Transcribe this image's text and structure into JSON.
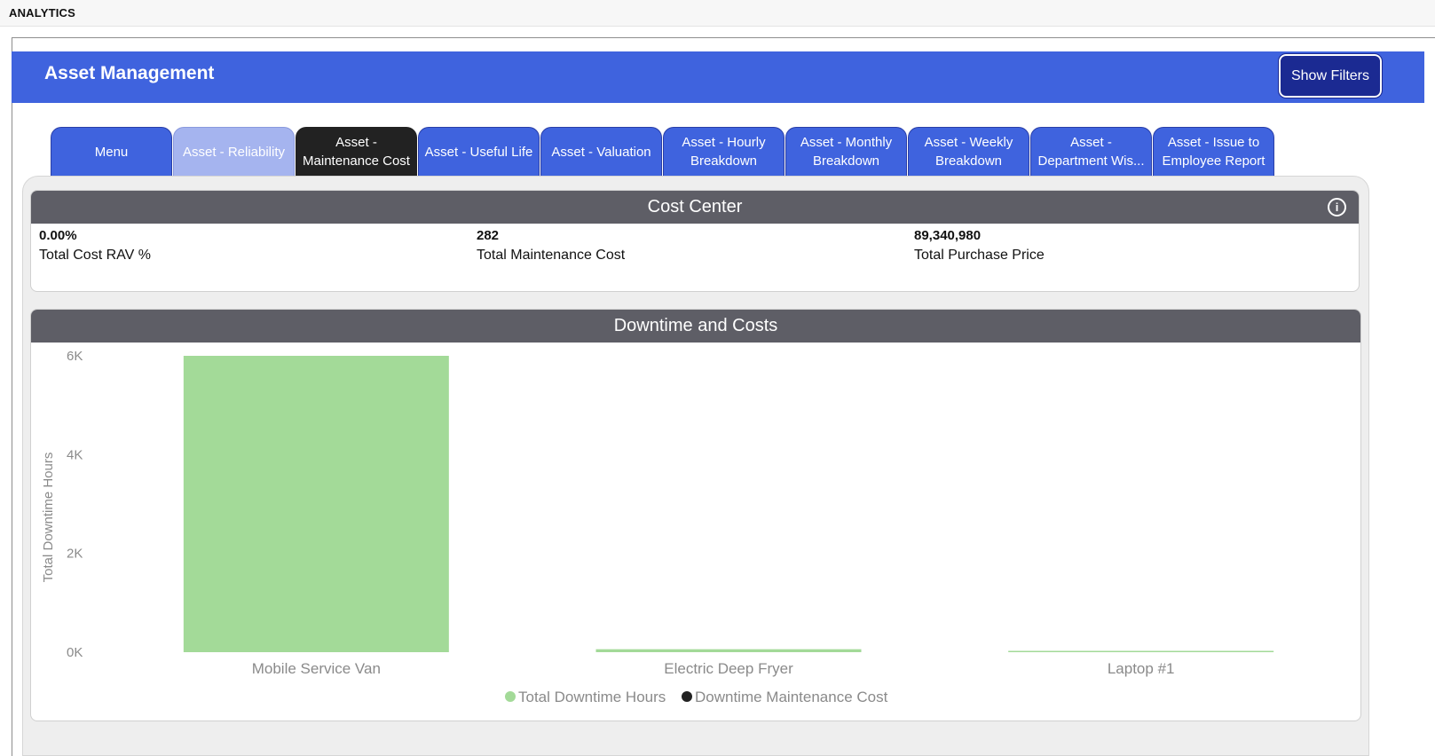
{
  "app": {
    "title": "ANALYTICS"
  },
  "header": {
    "title": "Asset Management",
    "filters_button": "Show Filters"
  },
  "tabs": [
    {
      "label": "Menu",
      "state": "normal"
    },
    {
      "label": "Asset - Reliability",
      "state": "hover"
    },
    {
      "label": "Asset -\nMaintenance Cost",
      "state": "active"
    },
    {
      "label": "Asset - Useful Life",
      "state": "normal"
    },
    {
      "label": "Asset - Valuation",
      "state": "normal"
    },
    {
      "label": "Asset - Hourly\nBreakdown",
      "state": "normal"
    },
    {
      "label": "Asset - Monthly\nBreakdown",
      "state": "normal"
    },
    {
      "label": "Asset - Weekly\nBreakdown",
      "state": "normal"
    },
    {
      "label": "Asset -\nDepartment Wis...",
      "state": "normal"
    },
    {
      "label": "Asset - Issue to\nEmployee Report",
      "state": "normal"
    }
  ],
  "cost_center": {
    "title": "Cost Center",
    "info_icon": "info-icon",
    "kpis": [
      {
        "value": "0.00%",
        "label": "Total Cost RAV %"
      },
      {
        "value": "282",
        "label": "Total Maintenance Cost"
      },
      {
        "value": "89,340,980",
        "label": "Total Purchase Price"
      }
    ]
  },
  "downtime_panel": {
    "title": "Downtime and Costs"
  },
  "colors": {
    "header_blue": "#3f63de",
    "tab_active": "#222222",
    "bar_green": "#a3da98",
    "series2_black": "#222222",
    "panel_head": "#5e5e66"
  },
  "chart_data": {
    "type": "bar",
    "categories": [
      "Mobile Service Van",
      "Electric Deep Fryer",
      "Laptop #1"
    ],
    "series": [
      {
        "name": "Total Downtime Hours",
        "values": [
          6000,
          60,
          10
        ],
        "color": "#a3da98"
      },
      {
        "name": "Downtime Maintenance Cost",
        "values": [
          0,
          0,
          0
        ],
        "color": "#222222"
      }
    ],
    "ylabel": "Total Downtime Hours",
    "ylim": [
      0,
      6000
    ],
    "yticks": [
      "0K",
      "2K",
      "4K",
      "6K"
    ],
    "ytick_values": [
      0,
      2000,
      4000,
      6000
    ],
    "legend": "bottom-center",
    "grid": false
  }
}
